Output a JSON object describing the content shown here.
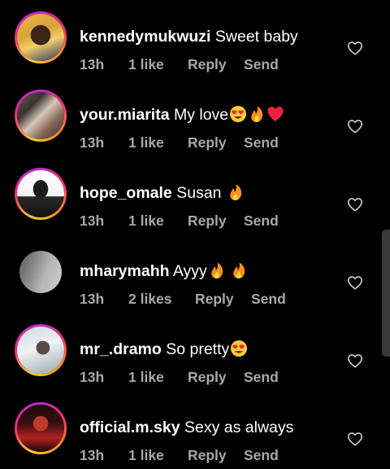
{
  "comments": [
    {
      "username": "kennedymukwuzi",
      "text": "Sweet baby",
      "time": "13h",
      "likes": "1 like",
      "reply": "Reply",
      "send": "Send",
      "emojis": []
    },
    {
      "username": "your.miarita",
      "text": "My love",
      "time": "13h",
      "likes": "1 like",
      "reply": "Reply",
      "send": "Send",
      "emojis": [
        "heart-eyes-emoji",
        "fire-emoji",
        "red-heart-emoji"
      ]
    },
    {
      "username": "hope_omale",
      "text": "Susan ",
      "time": "13h",
      "likes": "1 like",
      "reply": "Reply",
      "send": "Send",
      "emojis": [
        "fire-emoji"
      ]
    },
    {
      "username": "mharymahh",
      "text": "Ayyy",
      "time": "13h",
      "likes": "2 likes",
      "reply": "Reply",
      "send": "Send",
      "emojis": [
        "fire-emoji",
        "fire-emoji"
      ]
    },
    {
      "username": "mr_.dramo",
      "text": "So pretty",
      "time": "13h",
      "likes": "1 like",
      "reply": "Reply",
      "send": "Send",
      "emojis": [
        "heart-eyes-emoji"
      ]
    },
    {
      "username": "official.m.sky",
      "text": "Sexy as always",
      "time": "13h",
      "likes": "1 like",
      "reply": "Reply",
      "send": "Send",
      "emojis": []
    }
  ],
  "colors": {
    "background": "#000000",
    "secondary_text": "#a8a8a8",
    "story_ring": [
      "#f9ce34",
      "#ee2a7b",
      "#b82ad6"
    ]
  }
}
